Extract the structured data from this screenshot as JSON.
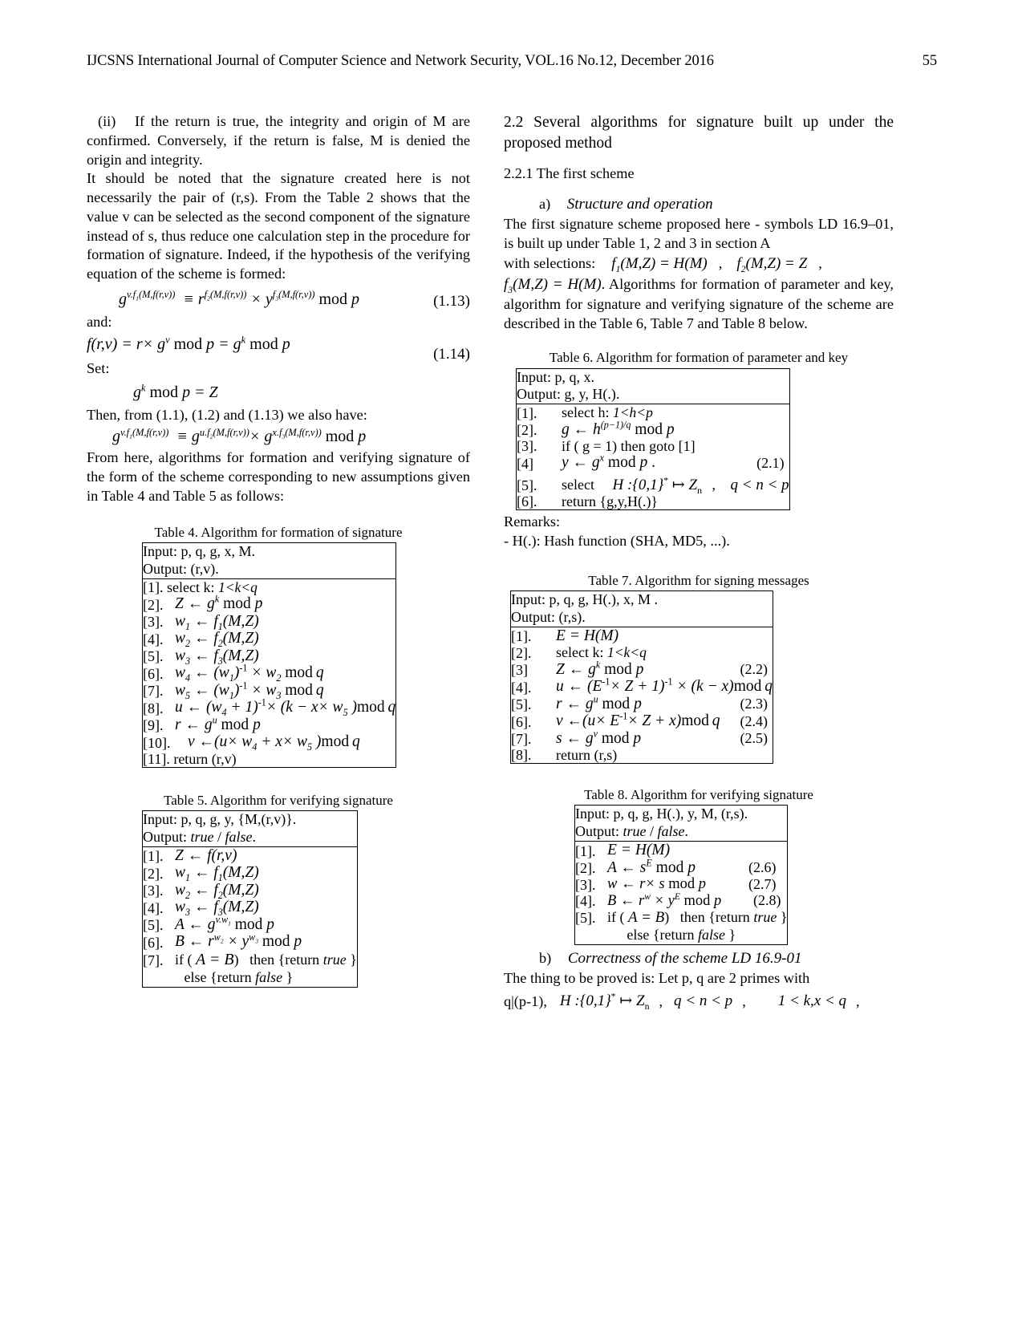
{
  "header": {
    "journal_line": "IJCSNS International Journal of Computer Science and Network Security, VOL.16 No.12, December 2016",
    "page_number": "55"
  },
  "left_column": {
    "p_ii_marker": "(ii)",
    "p_ii": "If the return is true, the integrity and origin of M are confirmed. Conversely, if the return is false, M is denied the origin and integrity.",
    "p_noted": "It should be noted that the signature created here is not necessarily the pair of (r,s). From the Table 2 shows that the value v can be selected as the second component of the signature instead of s, thus reduce one calculation step in the procedure for formation of signature. Indeed, if the hypothesis of the verifying equation of the scheme is formed:",
    "eq_113_num": "(1.13)",
    "and_label": "and:",
    "eq_114_num": "(1.14)",
    "set_label": "Set:",
    "then_line": "Then, from (1.1), (1.2) and (1.13) we also have:",
    "p_fromhere": "From here, algorithms for formation and verifying signature of the form of the scheme corresponding to new assumptions given in Table 4 and Table 5 as follows:"
  },
  "table4": {
    "caption": "Table 4. Algorithm for formation of signature",
    "input": "Input: p, q, g, x, M.",
    "output": "Output: (r,v).",
    "steps": [
      {
        "num": "[1].",
        "kind": "plain",
        "text": "select k:",
        "cond": "1<k<q"
      },
      {
        "num": "[2].",
        "kind": "math"
      },
      {
        "num": "[3].",
        "kind": "math"
      },
      {
        "num": "[4].",
        "kind": "math"
      },
      {
        "num": "[5].",
        "kind": "math"
      },
      {
        "num": "[6].",
        "kind": "math"
      },
      {
        "num": "[7].",
        "kind": "math"
      },
      {
        "num": "[8].",
        "kind": "math"
      },
      {
        "num": "[9].",
        "kind": "math"
      },
      {
        "num": "[10].",
        "kind": "math"
      },
      {
        "num": "[11].",
        "kind": "plain",
        "text": "return (r,v)"
      }
    ]
  },
  "table5": {
    "caption": "Table 5. Algorithm for verifying signature",
    "input": "Input: p, q, g, y, {M,(r,v)}.",
    "output_prefix": "Output:",
    "output_true": "true",
    "output_sep": "/",
    "output_false": "false",
    "output_end": ".",
    "steps": [
      {
        "num": "[1]."
      },
      {
        "num": "[2]."
      },
      {
        "num": "[3]."
      },
      {
        "num": "[4]."
      },
      {
        "num": "[5]."
      },
      {
        "num": "[6]."
      },
      {
        "num": "[7]."
      }
    ],
    "if_prefix": "if (",
    "if_suffix": ")",
    "then_text": "then {return",
    "true_word": "true",
    "brace_close": "}",
    "else_text": "else {return",
    "false_word": "false"
  },
  "right_column": {
    "section_title": "2.2 Several algorithms for signature built up under the proposed method",
    "subsection_title": "2.2.1 The first scheme",
    "a_label": "a)",
    "a_title": "Structure and operation",
    "p_first_1": "The first signature scheme proposed here - symbols LD 16.9–01, is built up under Table 1, 2 and 3 in section A",
    "with_selections": "with    selections:",
    "p_first_2": ". Algorithms for formation of parameter and key, algorithm for signature and verifying signature of the scheme are described in the Table 6, Table 7 and Table 8 below.",
    "remarks_label": "Remarks:",
    "remarks_text": "- H(.): Hash function (SHA, MD5, ...).",
    "b_label": "b)",
    "b_title": "Correctness of the scheme LD 16.9-01",
    "p_proved": "The thing to be proved is: Let p, q are 2 primes with",
    "q_divides": "q|(p-1),",
    "comma1": ",",
    "comma2": ",",
    "comma3": ","
  },
  "table6": {
    "caption": "Table 6. Algorithm for formation of parameter and key",
    "input": "Input: p, q, x.",
    "output": "Output: g, y, H(.).",
    "step1_num": "[1].",
    "step1_text": "select h:",
    "step1_cond": "1<h<p",
    "step2_num": "[2].",
    "step3_num": "[3].",
    "step3_text": "if ( g = 1) then goto [1]",
    "step4_num": "[4]",
    "step4_eqn": "(2.1)",
    "step5_num": "[5].",
    "step5_text": "select",
    "step6_num": "[6].",
    "step6_text": "return {g,y,H(.)}"
  },
  "table7": {
    "caption": "Table 7. Algorithm for signing messages",
    "input": "Input: p, q, g, H(.), x, M .",
    "output": "Output: (r,s).",
    "step1_num": "[1].",
    "step2_num": "[2].",
    "step2_text": "select k:",
    "step2_cond": "1<k<q",
    "step3_num": "[3]",
    "step3_eqn": "(2.2)",
    "step4_num": "[4].",
    "step5_num": "[5].",
    "step5_eqn": "(2.3)",
    "step6_num": "[6].",
    "step6_eqn": "(2.4)",
    "step7_num": "[7].",
    "step7_eqn": "(2.5)",
    "step8_num": "[8].",
    "step8_text": "return (r,s)"
  },
  "table8": {
    "caption": "Table 8. Algorithm for verifying signature",
    "input": "Input: p, q, g, H(.), y, M, (r,s).",
    "output_prefix": "Output:",
    "output_true": "true",
    "output_sep": "/",
    "output_false": "false",
    "output_end": ".",
    "step1_num": "[1].",
    "step2_num": "[2].",
    "step2_eqn": "(2.6)",
    "step3_num": "[3].",
    "step3_eqn": "(2.7)",
    "step4_num": "[4].",
    "step4_eqn": "(2.8)",
    "step5_num": "[5].",
    "if_prefix": "if (",
    "if_suffix": ")",
    "then_text": "then {return",
    "true_word": "true",
    "brace_close": "}",
    "else_text": "else {return",
    "false_word": "false"
  }
}
